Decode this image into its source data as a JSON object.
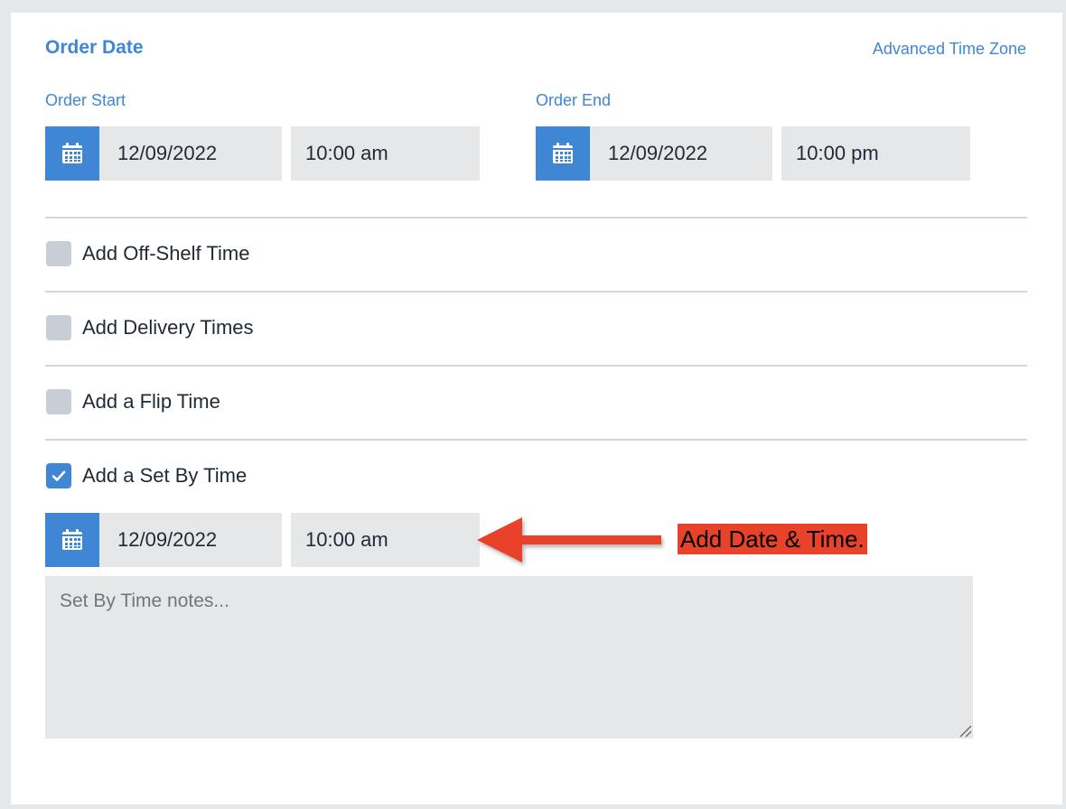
{
  "section": {
    "title": "Order Date",
    "advanced_tz_link": "Advanced Time Zone"
  },
  "order_start": {
    "label": "Order Start",
    "date": "12/09/2022",
    "time": "10:00 am"
  },
  "order_end": {
    "label": "Order End",
    "date": "12/09/2022",
    "time": "10:00 pm"
  },
  "options": [
    {
      "label": "Add Off-Shelf Time",
      "checked": false
    },
    {
      "label": "Add Delivery Times",
      "checked": false
    },
    {
      "label": "Add a Flip Time",
      "checked": false
    },
    {
      "label": "Add a Set By Time",
      "checked": true
    }
  ],
  "set_by": {
    "date": "12/09/2022",
    "time": "10:00 am",
    "notes_placeholder": "Set By Time notes..."
  },
  "annotation": {
    "text": "Add Date & Time.",
    "color": "#e8432a"
  },
  "colors": {
    "accent": "#3f86d4",
    "field_bg": "#e6e7e9",
    "checkbox_unchecked": "#c7ced6"
  },
  "icons": {
    "calendar": "calendar-icon",
    "checkmark": "checkmark-icon",
    "arrow": "arrow-left-icon",
    "resize": "resize-grip-icon"
  }
}
